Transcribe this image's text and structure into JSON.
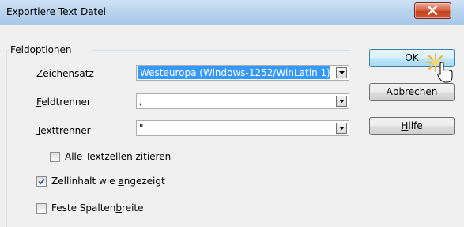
{
  "window": {
    "title": "Exportiere Text Datei"
  },
  "group": {
    "label": "Feldoptionen"
  },
  "fields": {
    "charset": {
      "label_pre": "",
      "label_key": "Z",
      "label_post": "eichensatz",
      "value": "Westeuropa (Windows-1252/WinLatin 1)"
    },
    "field_sep": {
      "label_pre": "",
      "label_key": "F",
      "label_post": "eldtrenner",
      "value": ","
    },
    "text_sep": {
      "label_pre": "",
      "label_key": "T",
      "label_post": "exttrenner",
      "value": "\""
    }
  },
  "options": {
    "quote_all": {
      "label_pre": "",
      "label_key": "A",
      "label_post": "lle Textzellen zitieren",
      "checked": false
    },
    "as_shown": {
      "label_pre": "Zellinhalt wie ",
      "label_key": "a",
      "label_post": "ngezeigt",
      "checked": true
    },
    "fixed_width": {
      "label_pre": "Feste Spalten",
      "label_key": "b",
      "label_post": "reite",
      "checked": false
    }
  },
  "buttons": {
    "ok": {
      "label_pre": "OK",
      "label_key": "",
      "label_post": ""
    },
    "cancel": {
      "label_pre": "",
      "label_key": "A",
      "label_post": "bbrechen"
    },
    "help": {
      "label_pre": "",
      "label_key": "H",
      "label_post": "ilfe"
    }
  }
}
